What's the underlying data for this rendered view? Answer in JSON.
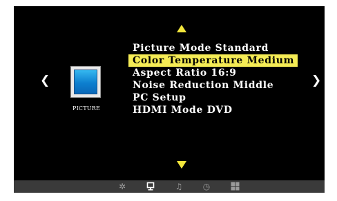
{
  "nav": {
    "up": "",
    "down": "",
    "left": "❮",
    "right": "❯"
  },
  "category": {
    "label": "PICTURE"
  },
  "menu": {
    "items": [
      {
        "label": "Picture Mode Standard",
        "selected": false
      },
      {
        "label": "Color Temperature Medium",
        "selected": true
      },
      {
        "label": "Aspect Ratio 16:9",
        "selected": false
      },
      {
        "label": "Noise Reduction Middle",
        "selected": false
      },
      {
        "label": "PC Setup",
        "selected": false
      },
      {
        "label": "HDMI Mode DVD",
        "selected": false
      }
    ]
  },
  "tabs": [
    {
      "icon": "sun-icon",
      "glyph": "✲",
      "active": false
    },
    {
      "icon": "tv-icon",
      "active": true
    },
    {
      "icon": "music-note-icon",
      "glyph": "♫",
      "active": false
    },
    {
      "icon": "clock-icon",
      "glyph": "◷",
      "active": false
    },
    {
      "icon": "grid-icon",
      "active": false
    }
  ],
  "colors": {
    "highlight": "#f5ec55",
    "arrow": "#f2e63c",
    "background": "#000000",
    "tabbar": "#3a3a3a"
  }
}
